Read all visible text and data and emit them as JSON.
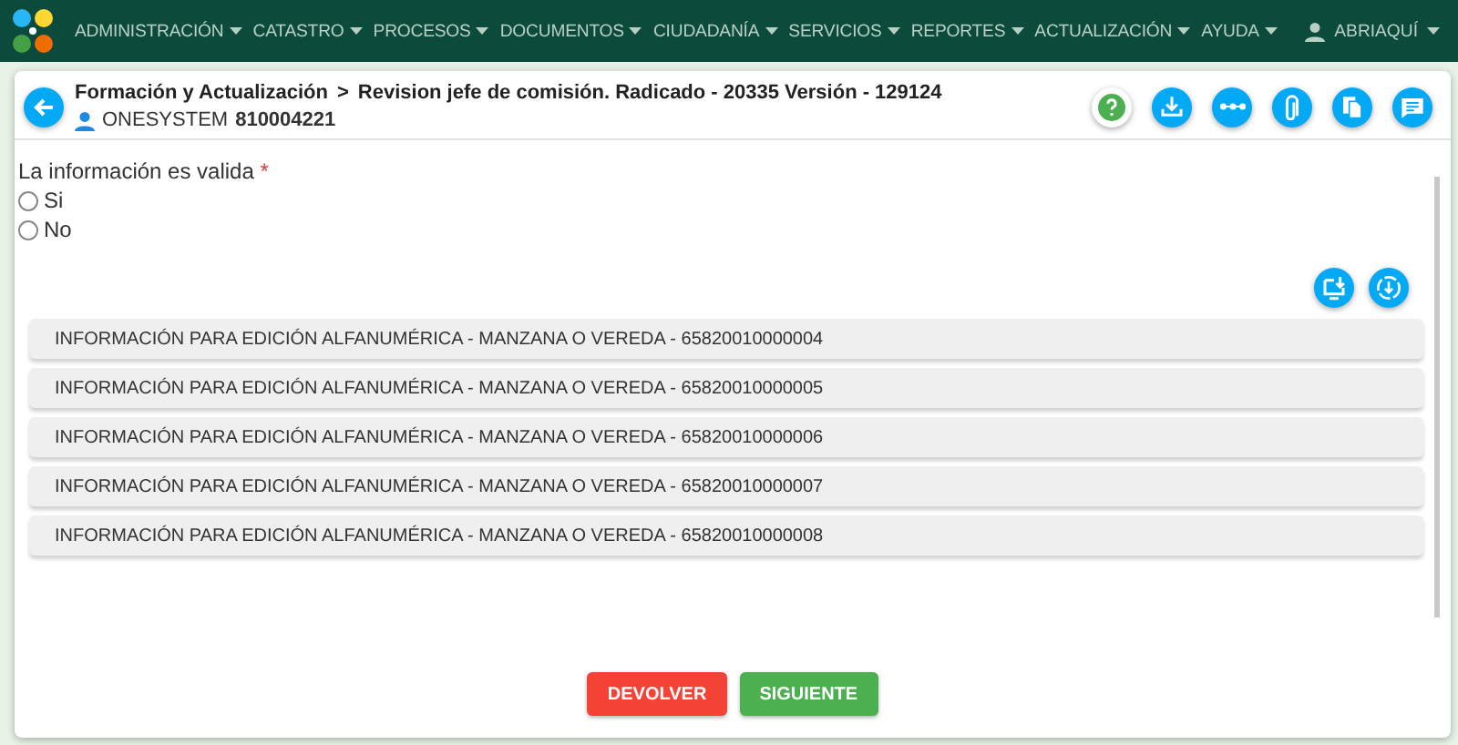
{
  "navbar": {
    "menus": [
      {
        "label": "ADMINISTRACIÓN"
      },
      {
        "label": "CATASTRO"
      },
      {
        "label": "PROCESOS"
      },
      {
        "label": "DOCUMENTOS"
      },
      {
        "label": "CIUDADANÍA"
      },
      {
        "label": "SERVICIOS"
      },
      {
        "label": "REPORTES"
      },
      {
        "label": "ACTUALIZACIÓN"
      },
      {
        "label": "AYUDA"
      }
    ],
    "user": "ABRIAQUÍ"
  },
  "header": {
    "breadcrumb_root": "Formación y Actualización",
    "separator": ">",
    "title": "Revision jefe de comisión. Radicado - 20335 Versión - 129124",
    "user_name": "ONESYSTEM",
    "user_id": "810004221",
    "actions": [
      {
        "kind": "help"
      },
      {
        "kind": "download"
      },
      {
        "kind": "more"
      },
      {
        "kind": "attach"
      },
      {
        "kind": "copy"
      },
      {
        "kind": "comment"
      }
    ]
  },
  "question": {
    "label": "La información es valida",
    "required_mark": "*",
    "options": [
      {
        "label": "Si",
        "selected": false
      },
      {
        "label": "No",
        "selected": false
      }
    ]
  },
  "tools": [
    {
      "kind": "screen-download"
    },
    {
      "kind": "circle-download"
    }
  ],
  "sections": [
    {
      "title": "INFORMACIÓN PARA EDICIÓN ALFANUMÉRICA - MANZANA O VEREDA - 65820010000004"
    },
    {
      "title": "INFORMACIÓN PARA EDICIÓN ALFANUMÉRICA - MANZANA O VEREDA - 65820010000005"
    },
    {
      "title": "INFORMACIÓN PARA EDICIÓN ALFANUMÉRICA - MANZANA O VEREDA - 65820010000006"
    },
    {
      "title": "INFORMACIÓN PARA EDICIÓN ALFANUMÉRICA - MANZANA O VEREDA - 65820010000007"
    },
    {
      "title": "INFORMACIÓN PARA EDICIÓN ALFANUMÉRICA - MANZANA O VEREDA - 65820010000008"
    }
  ],
  "buttons": [
    {
      "label": "DEVOLVER",
      "kind": "danger"
    },
    {
      "label": "SIGUIENTE",
      "kind": "success"
    }
  ]
}
